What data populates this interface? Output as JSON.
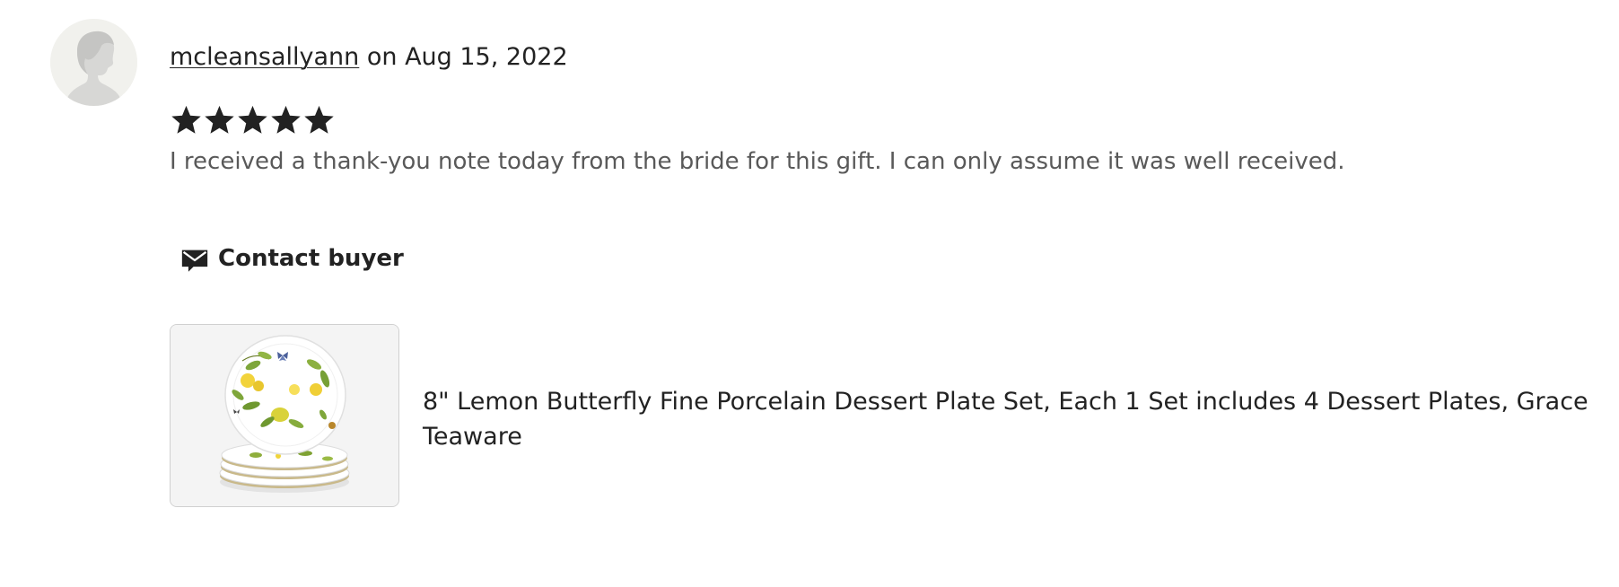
{
  "review": {
    "reviewer_name": "mcleansallyann",
    "date_prefix": " on ",
    "date": "Aug 15, 2022",
    "rating": 5,
    "rating_max": 5,
    "text": "I received a thank-you note today from the bride for this gift. I can only assume it was well received."
  },
  "contact": {
    "label": "Contact buyer",
    "icon": "envelope-icon"
  },
  "product": {
    "title": "8\" Lemon Butterfly Fine Porcelain Dessert Plate Set, Each 1 Set includes 4 Dessert Plates, Grace Teaware",
    "image_icon": "lemon-plate-image"
  },
  "colors": {
    "text_primary": "#222222",
    "text_secondary": "#595959",
    "avatar_bg": "#f1f1ed",
    "thumb_border": "#d0d0d0"
  }
}
